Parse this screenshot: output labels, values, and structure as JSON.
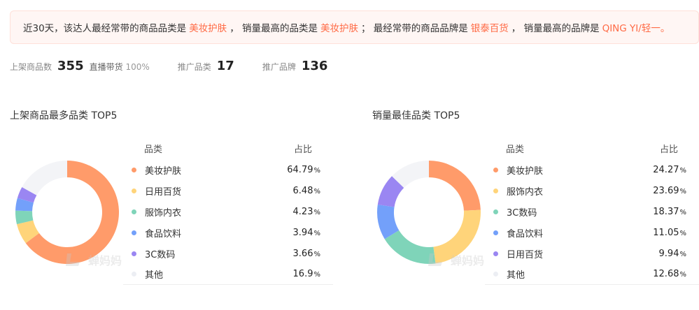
{
  "notice": {
    "p1": "近30天，该达人最经常带的商品品类是",
    "v1": "美妆护肤",
    "p2": "，  销量最高的品类是",
    "v2": "美妆护肤",
    "p3": "；  最经常带的商品品牌是",
    "v3": "银泰百货",
    "p4": "，  销量最高的品牌是",
    "v4": "QING YI/轻一。"
  },
  "stats": {
    "listed_label": "上架商品数",
    "listed_value": "355",
    "live_label": "直播带货",
    "live_pct": "100%",
    "category_label": "推广品类",
    "category_value": "17",
    "brand_label": "推广品牌",
    "brand_value": "136"
  },
  "watermark_text": "蝉妈妈",
  "colors": {
    "orange": "#ff9b6a",
    "yellow": "#ffd47a",
    "green": "#7fd4b9",
    "blue": "#73a0fa",
    "purple": "#9a86f2",
    "gray": "#f3f4f7",
    "highlight": "#ff6a45"
  },
  "chart_data": [
    {
      "type": "pie",
      "title": "上架商品最多品类 TOP5",
      "legend_header": [
        "品类",
        "占比"
      ],
      "categories": [
        "美妆护肤",
        "日用百货",
        "服饰内衣",
        "食品饮料",
        "3C数码",
        "其他"
      ],
      "values": [
        64.79,
        6.48,
        4.23,
        3.94,
        3.66,
        16.9
      ],
      "colors": [
        "#ff9b6a",
        "#ffd47a",
        "#7fd4b9",
        "#73a0fa",
        "#9a86f2",
        "#f3f4f7"
      ],
      "unit": "%"
    },
    {
      "type": "pie",
      "title": "销量最佳品类 TOP5",
      "legend_header": [
        "品类",
        "占比"
      ],
      "categories": [
        "美妆护肤",
        "服饰内衣",
        "3C数码",
        "食品饮料",
        "日用百货",
        "其他"
      ],
      "values": [
        24.27,
        23.69,
        18.37,
        11.05,
        9.94,
        12.68
      ],
      "colors": [
        "#ff9b6a",
        "#ffd47a",
        "#7fd4b9",
        "#73a0fa",
        "#9a86f2",
        "#f3f4f7"
      ],
      "unit": "%"
    }
  ]
}
